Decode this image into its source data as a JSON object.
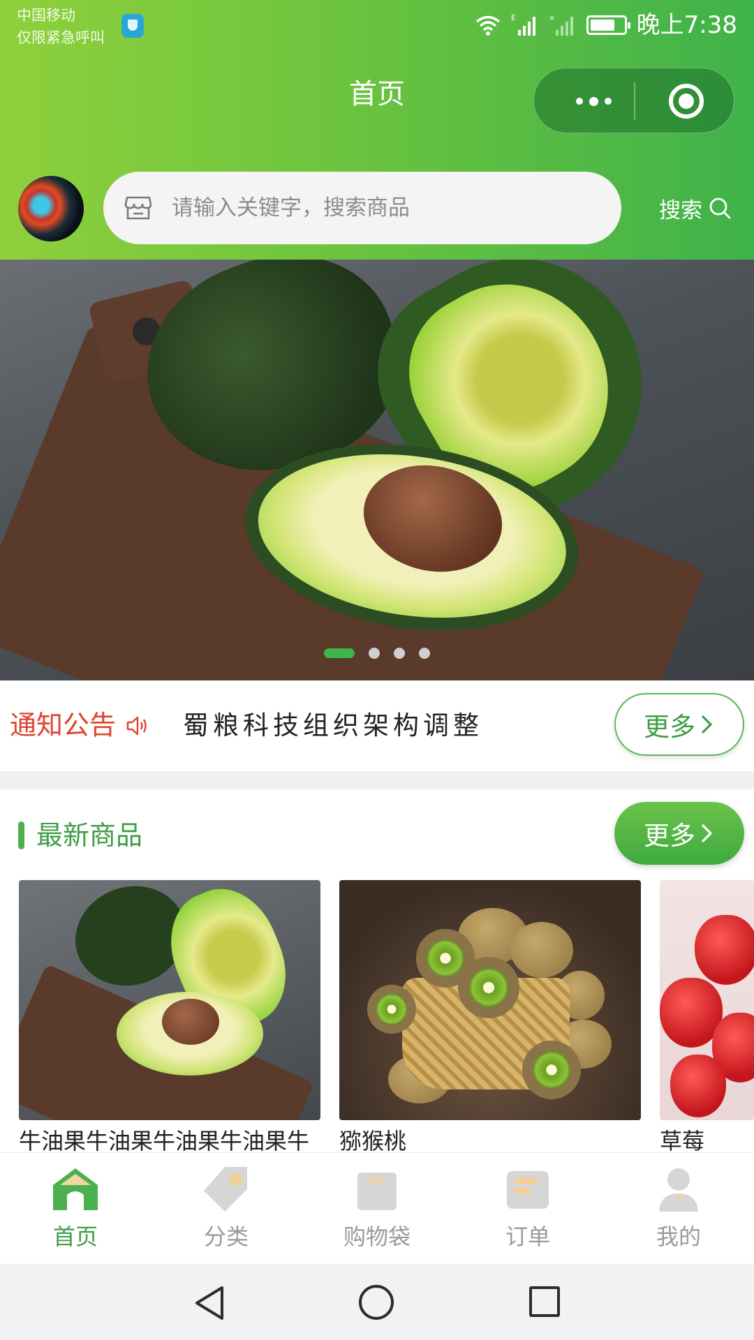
{
  "status_bar": {
    "carrier": "中国移动",
    "emergency": "仅限紧急呼叫",
    "time": "晚上7:38"
  },
  "nav": {
    "title": "首页"
  },
  "search": {
    "placeholder": "请输入关键字，搜索商品",
    "value": "",
    "button_label": "搜索"
  },
  "banner": {
    "slide_count": 4,
    "active_slide": 1
  },
  "notice": {
    "label": "通知公告",
    "text": "蜀粮科技组织架构调整",
    "more_label": "更多"
  },
  "new_products": {
    "title": "最新商品",
    "more_label": "更多",
    "items": [
      {
        "name": "牛油果牛油果牛油果牛油果牛"
      },
      {
        "name": "猕猴桃"
      },
      {
        "name": "草莓"
      }
    ]
  },
  "tabbar": {
    "items": [
      {
        "label": "首页",
        "icon": "home-icon",
        "active": true
      },
      {
        "label": "分类",
        "icon": "tag-icon",
        "active": false
      },
      {
        "label": "购物袋",
        "icon": "shopping-bag-icon",
        "active": false
      },
      {
        "label": "订单",
        "icon": "order-icon",
        "active": false
      },
      {
        "label": "我的",
        "icon": "user-icon",
        "active": false
      }
    ]
  },
  "colors": {
    "brand_green": "#3fb24a",
    "notice_red": "#e0432e",
    "inactive_gray": "#9a9a9a"
  }
}
